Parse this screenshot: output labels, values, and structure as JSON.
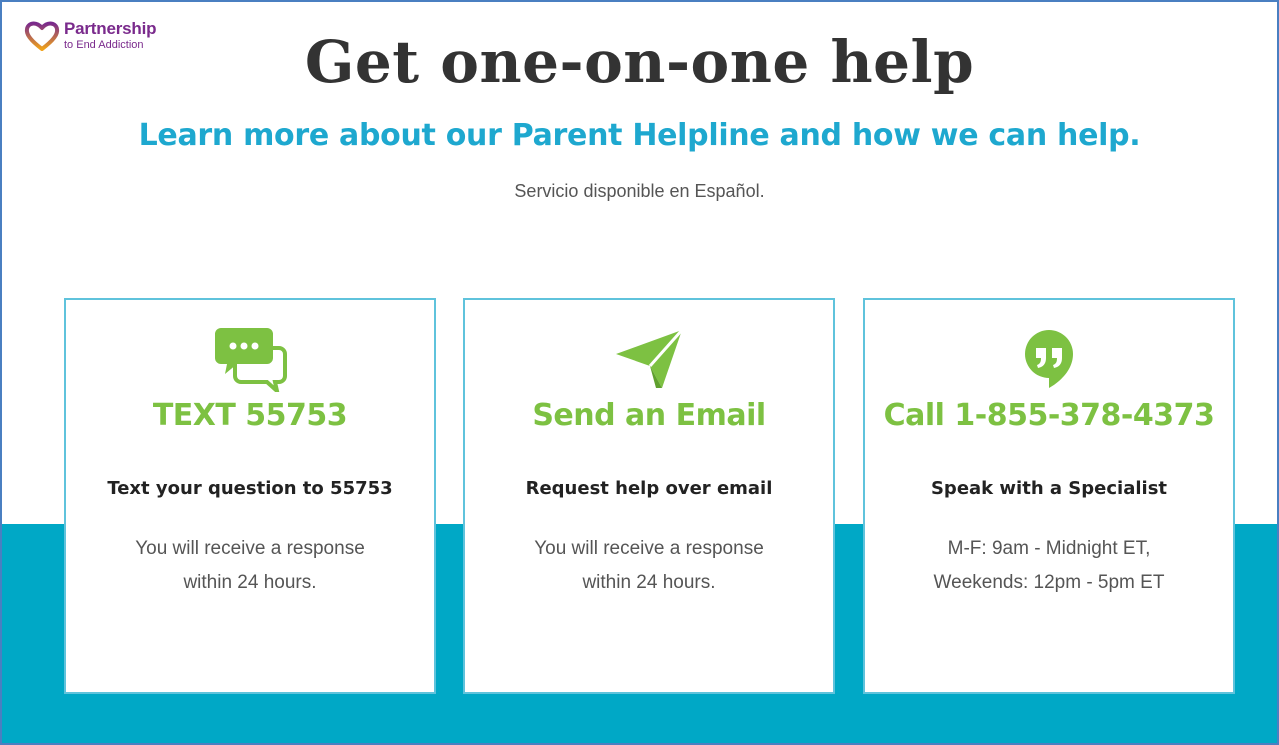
{
  "logo": {
    "line1": "Partnership",
    "line2": "to End Addiction"
  },
  "header": {
    "title": "Get one-on-one help",
    "subtitle": "Learn more about our Parent Helpline and how we can help.",
    "spanish_note": "Servicio disponible en Español."
  },
  "cards": [
    {
      "icon": "chat-bubbles-icon",
      "heading": "TEXT 55753",
      "subheading": "Text your question to 55753",
      "body_line1": "You will receive a response",
      "body_line2": "within 24 hours."
    },
    {
      "icon": "paper-plane-icon",
      "heading": "Send an Email",
      "subheading": "Request help over email",
      "body_line1": "You will receive a response",
      "body_line2": "within 24 hours."
    },
    {
      "icon": "quote-bubble-icon",
      "heading": "Call 1-855-378-4373",
      "subheading": "Speak with a Specialist",
      "body_line1": "M-F: 9am - Midnight ET,",
      "body_line2": "Weekends: 12pm - 5pm ET"
    }
  ],
  "colors": {
    "brand_purple": "#7a2a8c",
    "accent_blue": "#1ea8cf",
    "band_teal": "#00a8c6",
    "heading_green": "#7dc142",
    "card_border": "#5fc3dc"
  }
}
